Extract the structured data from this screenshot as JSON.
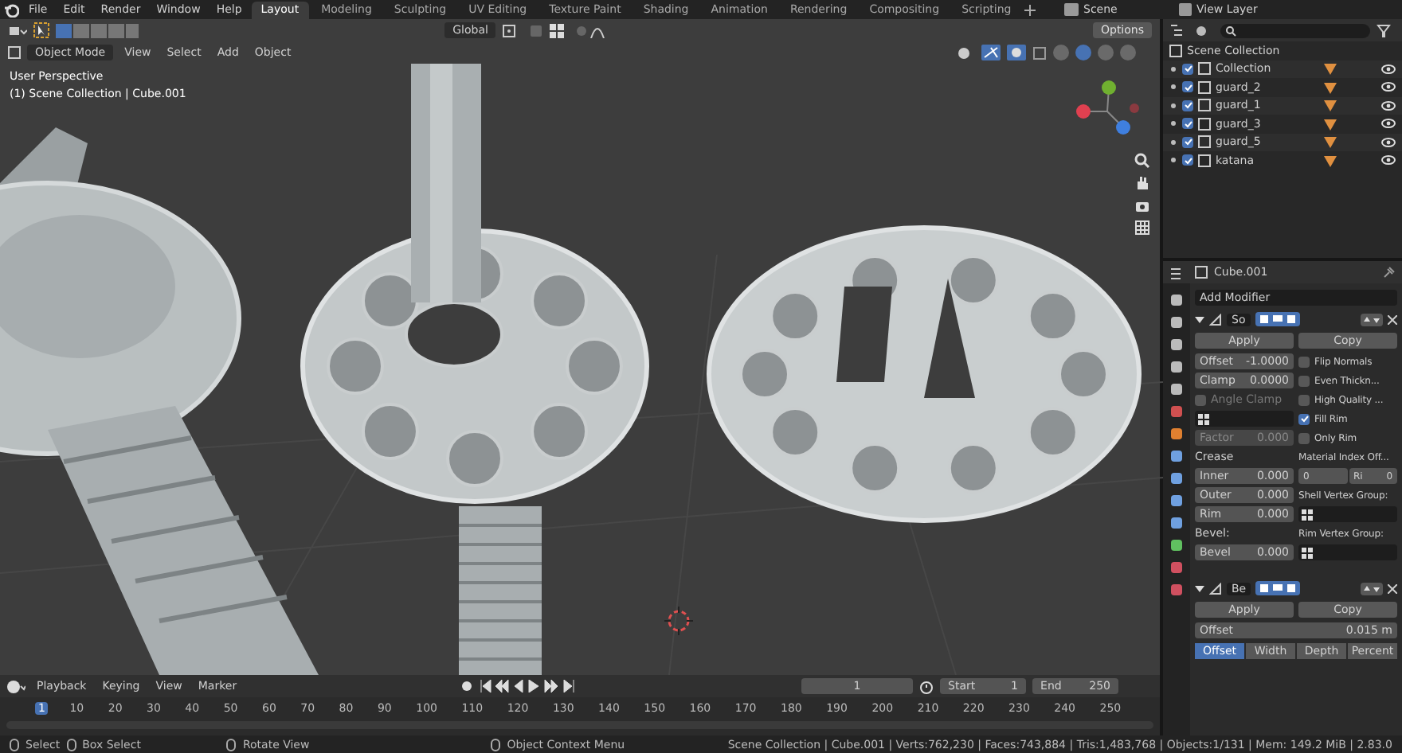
{
  "top_bar": {
    "menus": [
      "File",
      "Edit",
      "Render",
      "Window",
      "Help"
    ],
    "workspaces": [
      {
        "label": "Layout",
        "selected": true
      },
      {
        "label": "Modeling",
        "selected": false
      },
      {
        "label": "Sculpting",
        "selected": false
      },
      {
        "label": "UV Editing",
        "selected": false
      },
      {
        "label": "Texture Paint",
        "selected": false
      },
      {
        "label": "Shading",
        "selected": false
      },
      {
        "label": "Animation",
        "selected": false
      },
      {
        "label": "Rendering",
        "selected": false
      },
      {
        "label": "Compositing",
        "selected": false
      },
      {
        "label": "Scripting",
        "selected": false
      }
    ],
    "scene": "Scene",
    "view_layer": "View Layer"
  },
  "viewport": {
    "orientation": "Global",
    "options": "Options",
    "mode": "Object Mode",
    "menus": [
      "View",
      "Select",
      "Add",
      "Object"
    ],
    "shading_modes": [
      {
        "selected": false
      },
      {
        "selected": true
      },
      {
        "selected": false
      },
      {
        "selected": false
      }
    ],
    "overlay_lines": [
      "User Perspective",
      "(1) Scene Collection | Cube.001"
    ]
  },
  "outliner": {
    "root": "Scene Collection",
    "items": [
      {
        "name": "Collection",
        "checked": true
      },
      {
        "name": "guard_2",
        "checked": true
      },
      {
        "name": "guard_1",
        "checked": true
      },
      {
        "name": "guard_3",
        "checked": true
      },
      {
        "name": "guard_5",
        "checked": true
      },
      {
        "name": "katana",
        "checked": true
      }
    ]
  },
  "properties": {
    "object": "Cube.001",
    "add_modifier": "Add Modifier",
    "modifiers": [
      {
        "name": "So",
        "expanded": true,
        "apply": "Apply",
        "copy": "Copy",
        "left_fields": [
          {
            "kind": "field",
            "label": "Offset",
            "value": "-1.0000"
          },
          {
            "kind": "field",
            "label": "Clamp",
            "value": "0.0000"
          },
          {
            "kind": "check",
            "label": "Angle Clamp",
            "checked": false,
            "disabled": true
          },
          {
            "kind": "group"
          },
          {
            "kind": "field",
            "label": "Factor",
            "value": "0.000",
            "disabled": true
          },
          {
            "kind": "heading",
            "label": "Crease"
          },
          {
            "kind": "field",
            "label": "Inner",
            "value": "0.000"
          },
          {
            "kind": "field",
            "label": "Outer",
            "value": "0.000"
          },
          {
            "kind": "field",
            "label": "Rim",
            "value": "0.000"
          },
          {
            "kind": "heading",
            "label": "Bevel:"
          },
          {
            "kind": "field",
            "label": "Bevel",
            "value": "0.000"
          }
        ],
        "right_fields": [
          {
            "kind": "check",
            "label": "Flip Normals",
            "checked": false
          },
          {
            "kind": "check",
            "label": "Even Thickn...",
            "checked": false
          },
          {
            "kind": "check",
            "label": "High Quality ...",
            "checked": false
          },
          {
            "kind": "check",
            "label": "Fill Rim",
            "checked": true
          },
          {
            "kind": "check",
            "label": "Only Rim",
            "checked": false
          },
          {
            "kind": "heading",
            "label": "Material Index Off..."
          },
          {
            "kind": "pair",
            "fields": [
              {
                "value": "0"
              },
              {
                "label": "Ri",
                "value": "0"
              }
            ]
          },
          {
            "kind": "heading",
            "label": "Shell Vertex Group:"
          },
          {
            "kind": "group"
          },
          {
            "kind": "heading",
            "label": "Rim Vertex Group:"
          },
          {
            "kind": "group"
          }
        ]
      },
      {
        "name": "Be",
        "expanded": true,
        "apply": "Apply",
        "copy": "Copy",
        "left_fields": [
          {
            "kind": "field",
            "label": "Offset",
            "value": "0.015 m"
          }
        ],
        "tabs": [
          {
            "label": "Offset",
            "selected": true
          },
          {
            "label": "Width",
            "selected": false
          },
          {
            "label": "Depth",
            "selected": false
          },
          {
            "label": "Percent",
            "selected": false
          }
        ]
      }
    ]
  },
  "timeline": {
    "menus": [
      "Playback",
      "Keying",
      "View",
      "Marker"
    ],
    "frame": "1",
    "start_label": "Start",
    "start": "1",
    "end_label": "End",
    "end": "250",
    "ticks": [
      {
        "label": "1",
        "selected": true
      },
      {
        "label": "10",
        "selected": false
      },
      {
        "label": "20",
        "selected": false
      },
      {
        "label": "30",
        "selected": false
      },
      {
        "label": "40",
        "selected": false
      },
      {
        "label": "50",
        "selected": false
      },
      {
        "label": "60",
        "selected": false
      },
      {
        "label": "70",
        "selected": false
      },
      {
        "label": "80",
        "selected": false
      },
      {
        "label": "90",
        "selected": false
      },
      {
        "label": "100",
        "selected": false
      },
      {
        "label": "110",
        "selected": false
      },
      {
        "label": "120",
        "selected": false
      },
      {
        "label": "130",
        "selected": false
      },
      {
        "label": "140",
        "selected": false
      },
      {
        "label": "150",
        "selected": false
      },
      {
        "label": "160",
        "selected": false
      },
      {
        "label": "170",
        "selected": false
      },
      {
        "label": "180",
        "selected": false
      },
      {
        "label": "190",
        "selected": false
      },
      {
        "label": "200",
        "selected": false
      },
      {
        "label": "210",
        "selected": false
      },
      {
        "label": "220",
        "selected": false
      },
      {
        "label": "230",
        "selected": false
      },
      {
        "label": "240",
        "selected": false
      },
      {
        "label": "250",
        "selected": false
      }
    ]
  },
  "status_bar": {
    "hints": [
      "Select",
      "Box Select",
      "Rotate View",
      "Object Context Menu"
    ],
    "stats": "Scene Collection | Cube.001 | Verts:762,230 | Faces:743,884 | Tris:1,483,768 | Objects:1/131 | Mem: 149.2 MiB | 2.83.0"
  }
}
